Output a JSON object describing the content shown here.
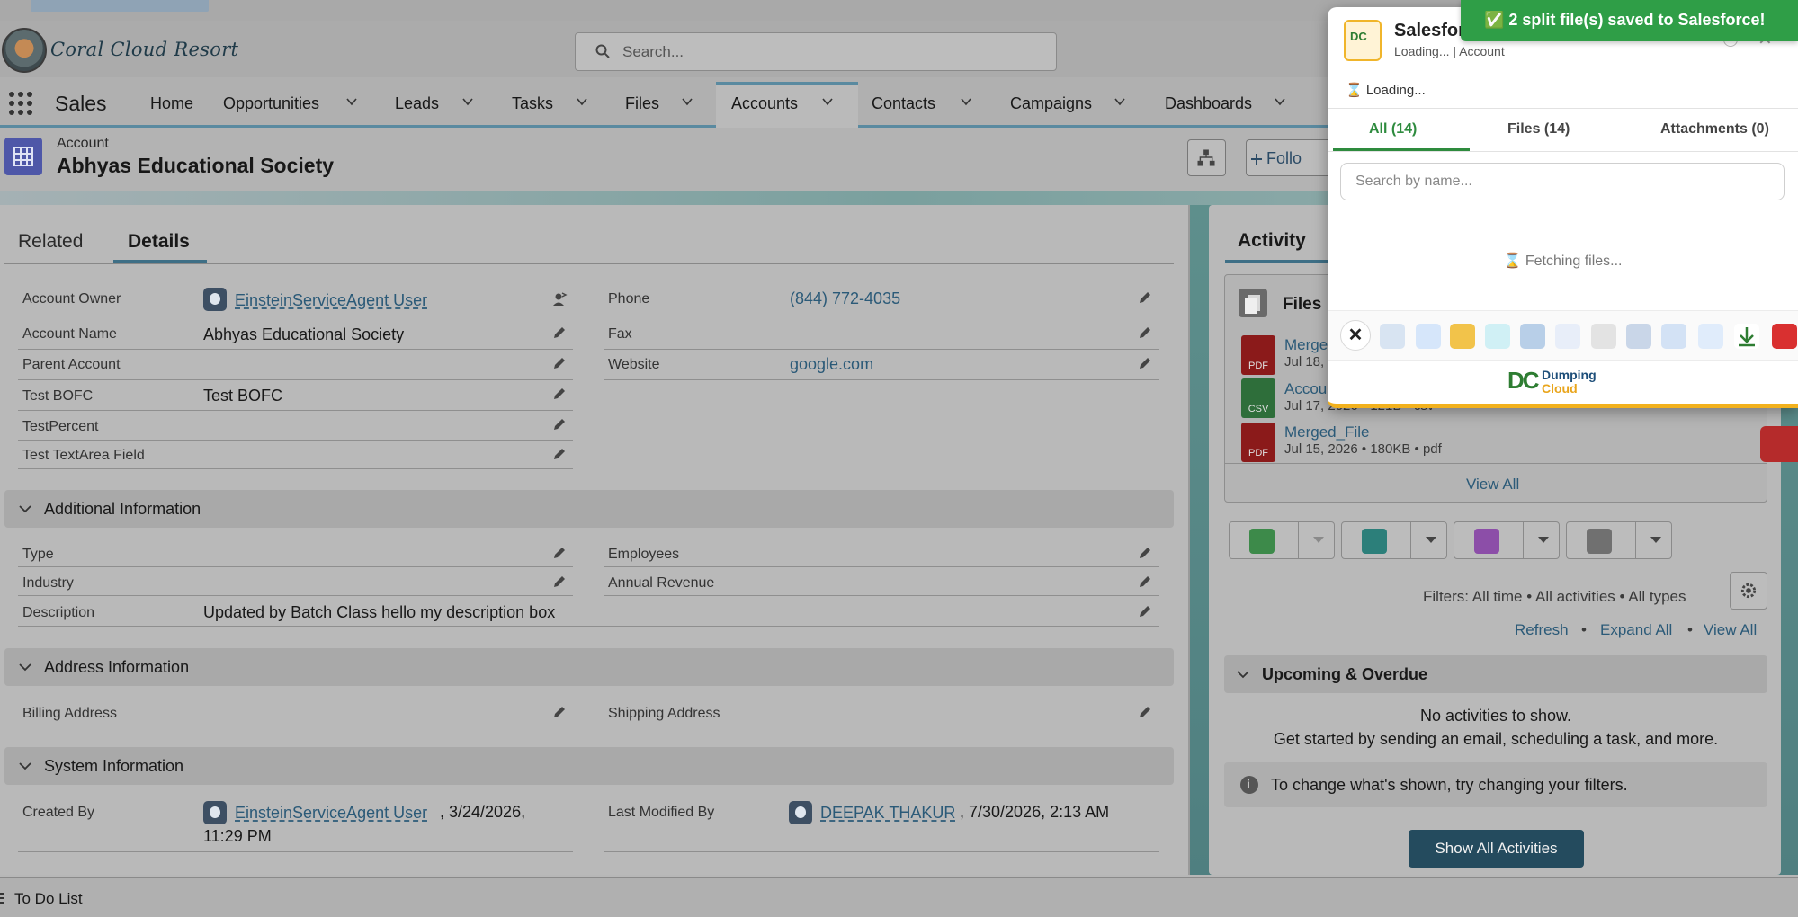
{
  "header": {
    "brand": "Coral Cloud Resort",
    "search_placeholder": "Search..."
  },
  "nav": {
    "app_name": "Sales",
    "items": [
      "Home",
      "Opportunities",
      "Leads",
      "Tasks",
      "Files",
      "Accounts",
      "Contacts",
      "Campaigns",
      "Dashboards"
    ],
    "active": "Accounts"
  },
  "record": {
    "object_label": "Account",
    "title": "Abhyas Educational Society",
    "follow_label": "Follo"
  },
  "tabs": {
    "related": "Related",
    "details": "Details"
  },
  "details": {
    "account_owner_label": "Account Owner",
    "account_owner_value": "EinsteinServiceAgent User",
    "account_name_label": "Account Name",
    "account_name_value": "Abhyas Educational Society",
    "parent_account_label": "Parent Account",
    "test_bofc_label": "Test BOFC",
    "test_bofc_value": "Test BOFC",
    "test_percent_label": "TestPercent",
    "test_textarea_label": "Test TextArea Field",
    "phone_label": "Phone",
    "phone_value": "(844) 772-4035",
    "fax_label": "Fax",
    "website_label": "Website",
    "website_value": "google.com"
  },
  "sections": {
    "additional": "Additional Information",
    "address": "Address Information",
    "system": "System Information"
  },
  "additional": {
    "type_label": "Type",
    "industry_label": "Industry",
    "description_label": "Description",
    "description_value": "Updated by Batch Class hello my description box",
    "employees_label": "Employees",
    "annual_revenue_label": "Annual Revenue"
  },
  "address": {
    "billing_label": "Billing Address",
    "shipping_label": "Shipping Address"
  },
  "system": {
    "created_by_label": "Created By",
    "created_by_user": "EinsteinServiceAgent User",
    "created_by_date_1": ", 3/24/2026,",
    "created_by_date_2": "11:29 PM",
    "modified_by_label": "Last Modified By",
    "modified_by_user": "DEEPAK THAKUR",
    "modified_by_date": ", 7/30/2026, 2:13 AM"
  },
  "activity": {
    "tab": "Activity",
    "files_title": "Files",
    "files": [
      {
        "name": "Merge",
        "meta": "Jul 18,",
        "type": "PDF",
        "color": "#8b1a1a"
      },
      {
        "name": "Accou",
        "meta": "Jul 17, 2026 • 121B • csv",
        "type": "CSV",
        "color": "#2e6e3a"
      },
      {
        "name": "Merged_File",
        "meta": "Jul 15, 2026 • 180KB • pdf",
        "type": "PDF",
        "color": "#8b1a1a"
      }
    ],
    "view_all_files": "View All",
    "filters": "Filters: All time • All activities • All types",
    "refresh": "Refresh",
    "expand_all": "Expand All",
    "view_all": "View All",
    "upcoming": "Upcoming & Overdue",
    "no_activities": "No activities to show.",
    "get_started": "Get started by sending an email, scheduling a task, and more.",
    "info": "To change what's shown, try changing your filters.",
    "show_all": "Show All Activities",
    "separator": "•"
  },
  "todo": "To Do List",
  "popup": {
    "title": "Salesfor",
    "subtitle": "Loading... | Account",
    "loading": "⌛ Loading...",
    "tab_all": "All (14)",
    "tab_files": "Files (14)",
    "tab_attachments": "Attachments (0)",
    "search_placeholder": "Search by name...",
    "fetching": "⌛ Fetching files...",
    "brand_line1": "Dumping",
    "brand_line2": "Cloud",
    "logo_text": "DC"
  },
  "toast": "✅ 2 split file(s) saved to Salesforce!"
}
